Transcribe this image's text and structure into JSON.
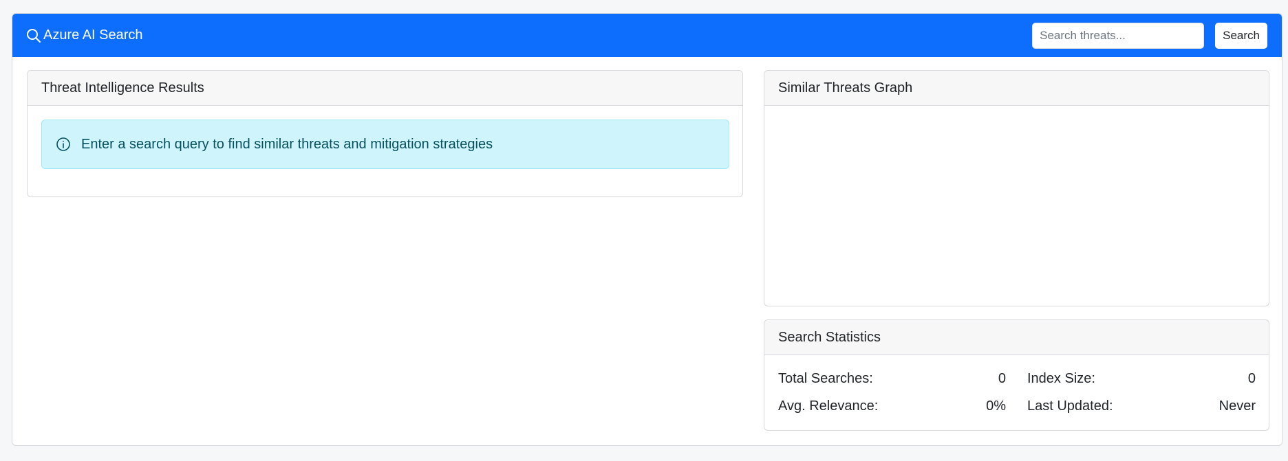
{
  "navbar": {
    "brand_label": "Azure AI Search",
    "brand_icon": "search-icon",
    "search_placeholder": "Search threats...",
    "search_value": "",
    "search_button_label": "Search"
  },
  "results": {
    "title": "Threat Intelligence Results",
    "alert_icon": "info-circle-icon",
    "alert_text": "Enter a search query to find similar threats and mitigation strategies"
  },
  "graph": {
    "title": "Similar Threats Graph"
  },
  "stats": {
    "title": "Search Statistics",
    "total_searches_label": "Total Searches:",
    "total_searches_value": "0",
    "index_size_label": "Index Size:",
    "index_size_value": "0",
    "avg_relevance_label": "Avg. Relevance:",
    "avg_relevance_value": "0%",
    "last_updated_label": "Last Updated:",
    "last_updated_value": "Never"
  },
  "colors": {
    "primary": "#0d6efd",
    "info_bg": "#cff4fc",
    "info_text": "#055160"
  }
}
